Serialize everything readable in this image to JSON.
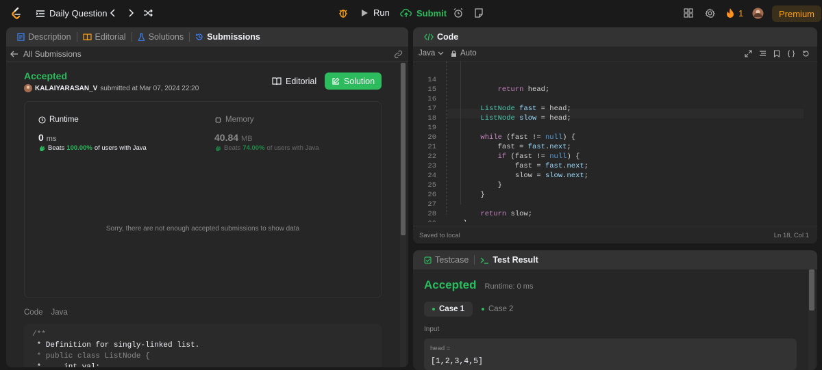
{
  "topbar": {
    "title": "Daily Question",
    "run_label": "Run",
    "submit_label": "Submit",
    "streak_count": "1",
    "premium_label": "Premium",
    "colors": {
      "accent_green": "#2cbb5d",
      "premium": "#ffa116",
      "fire": "#ff8f1f"
    }
  },
  "left_tabs": [
    {
      "label": "Description",
      "icon": "description-icon"
    },
    {
      "label": "Editorial",
      "icon": "book-icon"
    },
    {
      "label": "Solutions",
      "icon": "flask-icon"
    },
    {
      "label": "Submissions",
      "icon": "history-icon"
    }
  ],
  "submission": {
    "back_label": "All Submissions",
    "status": "Accepted",
    "username": "KALAIYARASAN_V",
    "submitted_text": "submitted at Mar 07, 2024 22:20",
    "editorial_button": "Editorial",
    "solution_button": "Solution",
    "runtime_label": "Runtime",
    "runtime_value": "0",
    "runtime_unit": "ms",
    "runtime_beats_prefix": "Beats",
    "runtime_beats_pct": "100.00%",
    "runtime_beats_suffix": "of users with Java",
    "memory_label": "Memory",
    "memory_value": "40.84",
    "memory_unit": "MB",
    "memory_beats_prefix": "Beats",
    "memory_beats_pct": "74.00%",
    "memory_beats_suffix": "of users with Java",
    "empty_message": "Sorry, there are not enough accepted submissions to show data",
    "code_label": "Code",
    "code_lang": "Java",
    "code_snippet": [
      "/**",
      " * Definition for singly-linked list.",
      " * public class ListNode {",
      " *     int val;"
    ]
  },
  "editor": {
    "title": "Code",
    "language": "Java",
    "mode": "Auto",
    "saved_text": "Saved to local",
    "cursor_text": "Ln 18, Col 1",
    "lines": [
      {
        "n": "14",
        "text": "            return head;"
      },
      {
        "n": "15",
        "text": ""
      },
      {
        "n": "16",
        "text": "        ListNode fast = head;"
      },
      {
        "n": "17",
        "text": "        ListNode slow = head;"
      },
      {
        "n": "18",
        "text": ""
      },
      {
        "n": "19",
        "text": "        while (fast != null) {"
      },
      {
        "n": "20",
        "text": "            fast = fast.next;"
      },
      {
        "n": "21",
        "text": "            if (fast != null) {"
      },
      {
        "n": "22",
        "text": "                fast = fast.next;"
      },
      {
        "n": "23",
        "text": "                slow = slow.next;"
      },
      {
        "n": "24",
        "text": "            }"
      },
      {
        "n": "25",
        "text": "        }"
      },
      {
        "n": "26",
        "text": ""
      },
      {
        "n": "27",
        "text": "        return slow;"
      },
      {
        "n": "28",
        "text": "    }"
      },
      {
        "n": "29",
        "text": "}"
      }
    ]
  },
  "result": {
    "testcase_tab": "Testcase",
    "result_tab": "Test Result",
    "status": "Accepted",
    "runtime_text": "Runtime: 0 ms",
    "cases": [
      "Case 1",
      "Case 2"
    ],
    "input_label": "Input",
    "var_label": "head =",
    "var_value": "[1,2,3,4,5]"
  }
}
